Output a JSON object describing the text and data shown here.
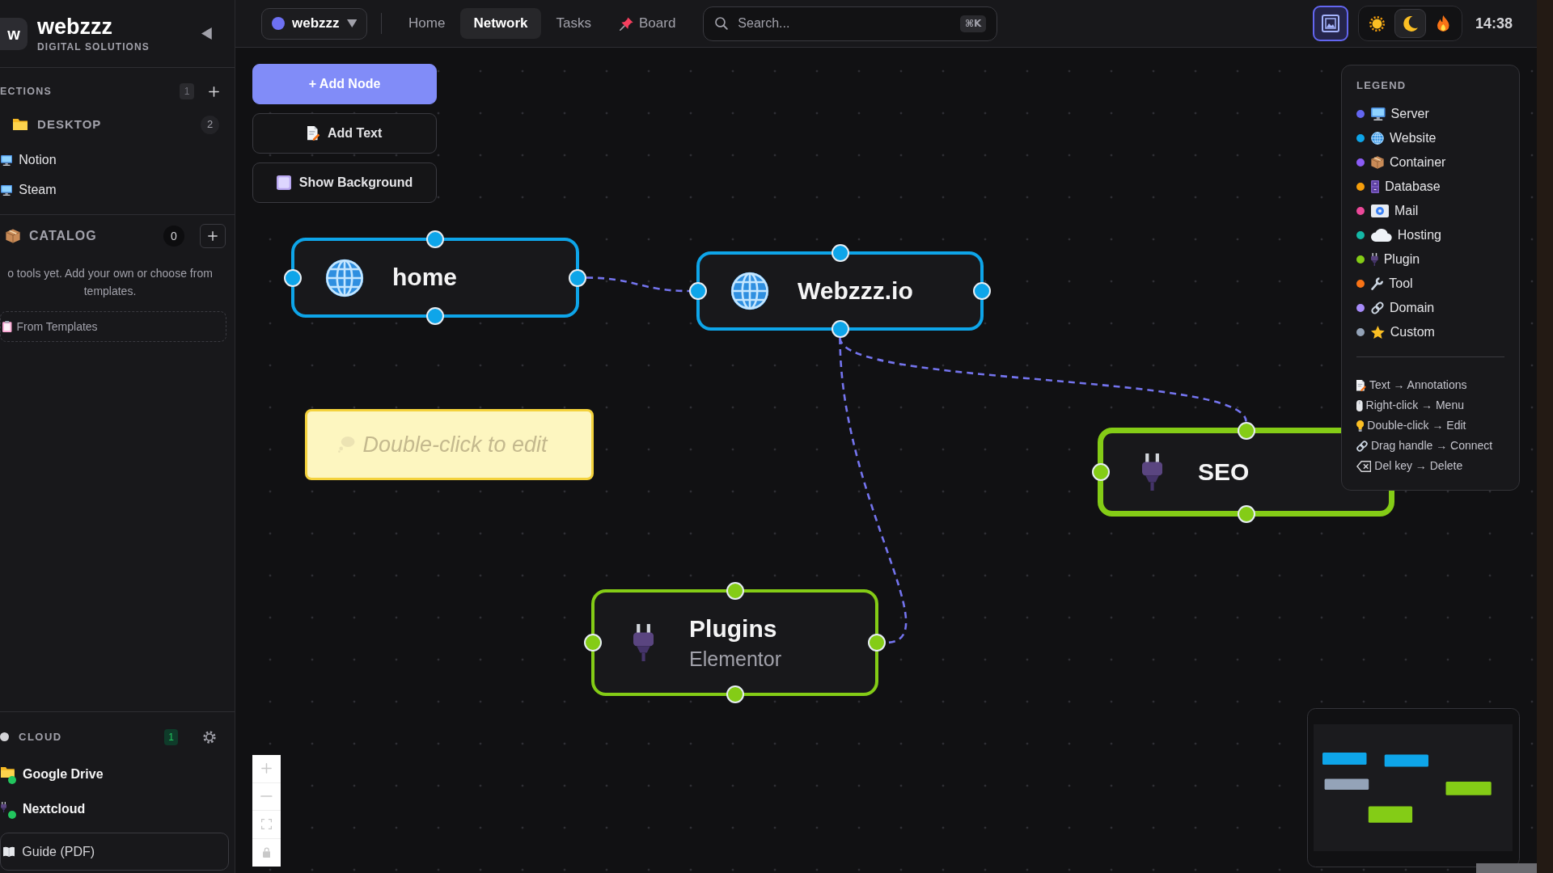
{
  "sidebar": {
    "brand": {
      "logo": "w",
      "name": "webzzz",
      "tagline": "DIGITAL SOLUTIONS"
    },
    "connections": {
      "title": "ECTIONS",
      "count": "1",
      "folder": {
        "name": "DESKTOP",
        "count": "2"
      },
      "items": [
        {
          "name": "Notion"
        },
        {
          "name": "Steam"
        }
      ]
    },
    "catalog": {
      "title": "CATALOG",
      "count": "0",
      "empty_text": "o tools yet. Add your own or choose from templates.",
      "templates_button": "From Templates"
    },
    "cloud": {
      "title": "CLOUD",
      "count": "1",
      "items": [
        {
          "name": "Google Drive",
          "online": true
        },
        {
          "name": "Nextcloud",
          "online": true
        }
      ]
    },
    "guide_button": "Guide (PDF)"
  },
  "topbar": {
    "workspace": "webzzz",
    "nav": [
      {
        "label": "Home",
        "selected": false,
        "pinned": false
      },
      {
        "label": "Network",
        "selected": true,
        "pinned": false
      },
      {
        "label": "Tasks",
        "selected": false,
        "pinned": false
      },
      {
        "label": "Board",
        "selected": false,
        "pinned": true
      }
    ],
    "search": {
      "placeholder": "Search...",
      "shortcut": "⌘K"
    },
    "view_button_active": true,
    "themes": [
      {
        "selected": false
      },
      {
        "selected": true
      },
      {
        "selected": false
      }
    ],
    "time": "14:38"
  },
  "canvas": {
    "tools": [
      {
        "label": "+ Add Node",
        "primary": true
      },
      {
        "label": "Add Text",
        "primary": false
      },
      {
        "label": "Show Background",
        "primary": false
      }
    ],
    "nodes": [
      {
        "kind": "website",
        "title": "home",
        "selected": false
      },
      {
        "kind": "website",
        "title": "Webzzz.io",
        "selected": false
      },
      {
        "kind": "note",
        "text": "Double-click to edit",
        "selected": false
      },
      {
        "kind": "plugin",
        "title": "SEO",
        "selected": true
      },
      {
        "kind": "plugin",
        "title": "Plugins",
        "subtitle": "Elementor",
        "selected": false
      }
    ]
  },
  "legend": {
    "title": "LEGEND",
    "types": [
      {
        "kind": "server",
        "label": "Server",
        "color": "#6366f1"
      },
      {
        "kind": "website",
        "label": "Website",
        "color": "#0ea5e9"
      },
      {
        "kind": "container",
        "label": "Container",
        "color": "#8b5cf6"
      },
      {
        "kind": "database",
        "label": "Database",
        "color": "#f59e0b"
      },
      {
        "kind": "mail",
        "label": "Mail",
        "color": "#ec4899"
      },
      {
        "kind": "hosting",
        "label": "Hosting",
        "color": "#14b8a6"
      },
      {
        "kind": "plugin",
        "label": "Plugin",
        "color": "#84cc16"
      },
      {
        "kind": "tool",
        "label": "Tool",
        "color": "#f97316"
      },
      {
        "kind": "domain",
        "label": "Domain",
        "color": "#a78bfa"
      },
      {
        "kind": "custom",
        "label": "Custom",
        "color": "#94a3b8"
      }
    ],
    "hints": [
      "Text → Annotations",
      "Right-click → Menu",
      "Double-click → Edit",
      "Drag handle → Connect",
      "Del key → Delete"
    ]
  }
}
